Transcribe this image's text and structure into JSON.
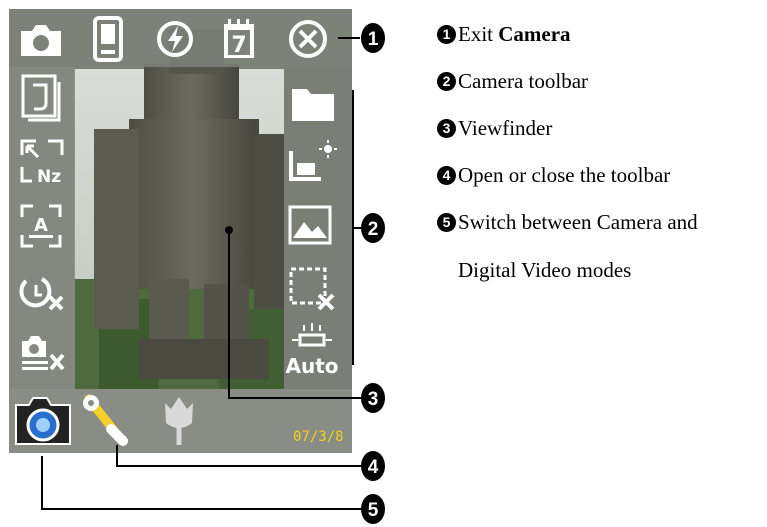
{
  "screen": {
    "date_stamp": "07/3/8",
    "auto_label": "Auto",
    "calendar_day": "7",
    "icons": {
      "top_bar": [
        "camera-icon",
        "pda-device-icon",
        "flash-icon",
        "calendar-icon",
        "exit-icon"
      ],
      "left_bar": [
        "frame-icon",
        "size-icon",
        "zoom-icon",
        "timer-icon",
        "burst-icon"
      ],
      "right_bar": [
        "folder-icon",
        "brightness-icon",
        "scene-icon",
        "frame-off-icon",
        "white-balance-auto-icon"
      ],
      "bottom_bar": [
        "camera-mode-icon",
        "tools-icon",
        "tulip-icon"
      ]
    }
  },
  "callouts": {
    "numbers": [
      "1",
      "2",
      "3",
      "4",
      "5"
    ]
  },
  "legend": {
    "items": [
      {
        "num": "1",
        "text": "Exit ",
        "bold": "Camera"
      },
      {
        "num": "2",
        "text": "Camera toolbar"
      },
      {
        "num": "3",
        "text": "Viewfinder"
      },
      {
        "num": "4",
        "text": "Open or close the toolbar"
      },
      {
        "num": "5",
        "text": "Switch between Camera and"
      }
    ],
    "continuation": "Digital Video modes"
  },
  "colors": {
    "badge": "#000000",
    "date": "#f2d21c",
    "icon": "#ffffff"
  }
}
